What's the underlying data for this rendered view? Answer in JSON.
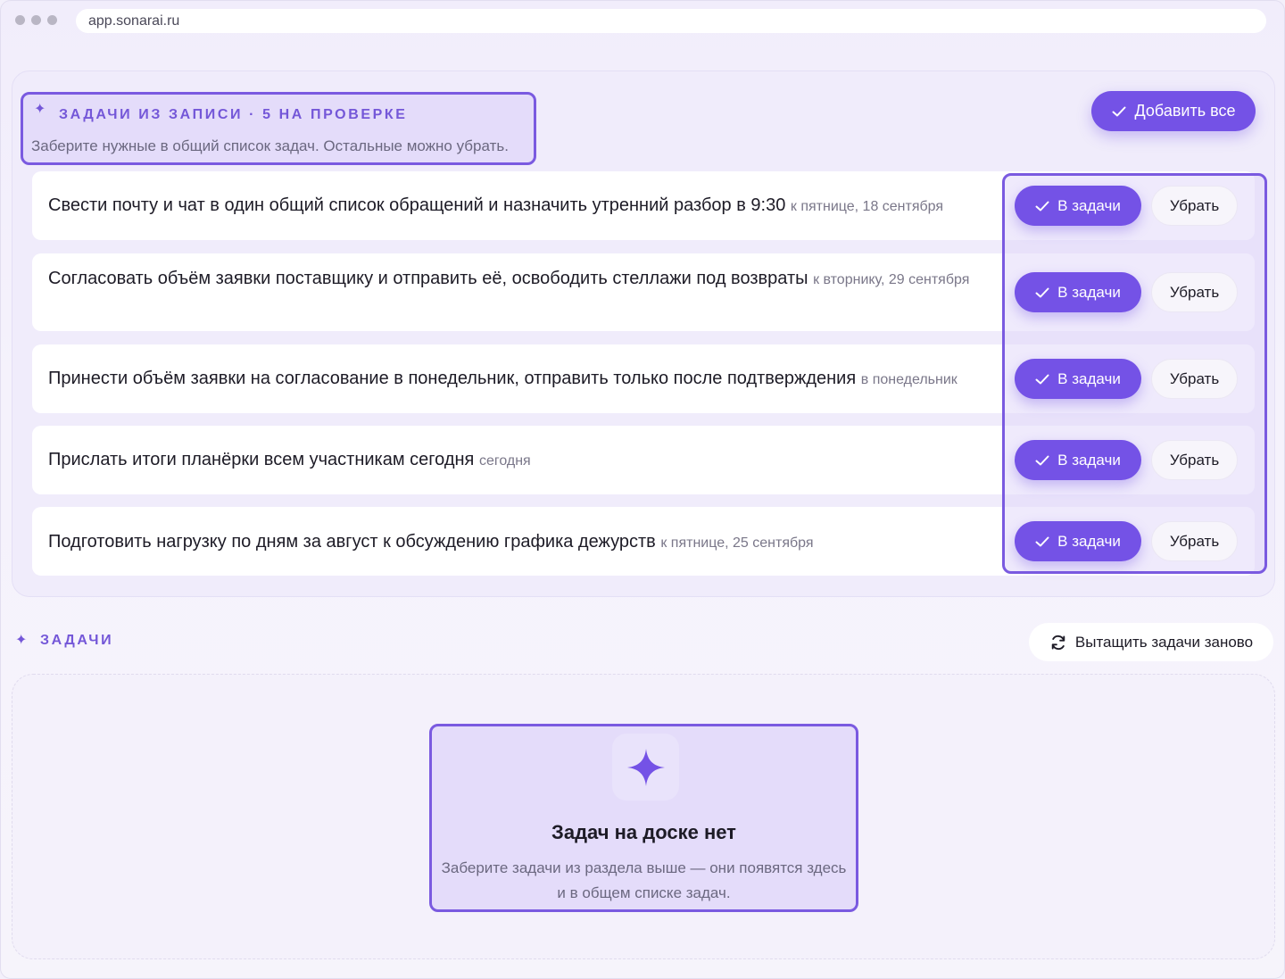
{
  "browser": {
    "url": "app.sonarai.ru"
  },
  "review": {
    "title": "Задачи из записи · 5 на проверке",
    "subtitle": "Заберите нужные в общий список задач. Остальные можно убрать.",
    "add_all_label": "Добавить все",
    "accept_label": "В задачи",
    "remove_label": "Убрать",
    "tasks": [
      {
        "text": "Свести почту и чат в один общий список обращений и назначить утренний разбор в 9:30",
        "due": "к пятнице, 18 сентября"
      },
      {
        "text": "Согласовать объём заявки поставщику и отправить её, освободить стеллажи под возвраты",
        "due": "к вторнику, 29 сентября"
      },
      {
        "text": "Принести объём заявки на согласование в понедельник, отправить только после подтверждения",
        "due": "в понедельник"
      },
      {
        "text": "Прислать итоги планёрки всем участникам сегодня",
        "due": "сегодня"
      },
      {
        "text": "Подготовить нагрузку по дням за август к обсуждению графика дежурств",
        "due": "к пятнице, 25 сентября"
      }
    ]
  },
  "board": {
    "label": "Задачи",
    "refresh_label": "Вытащить задачи заново",
    "empty_title": "Задач на доске нет",
    "empty_subtitle": "Заберите задачи из раздела выше — они появятся здесь и в общем списке задач."
  },
  "colors": {
    "accent": "#7452e6",
    "highlight_border": "#7a5ae0"
  }
}
